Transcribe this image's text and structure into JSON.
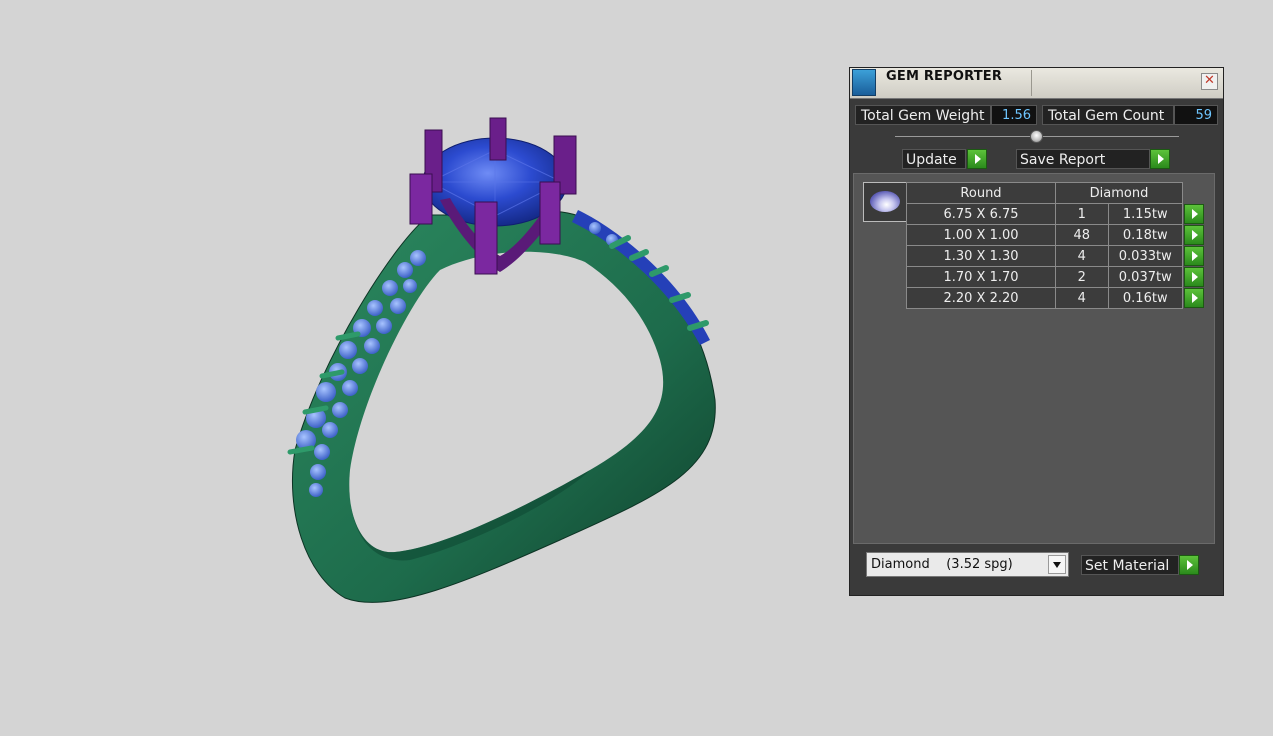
{
  "panel": {
    "title": "GEM REPORTER",
    "close_glyph": "✕",
    "total_weight_label": "Total Gem Weight",
    "total_weight_value": "1.56",
    "total_count_label": "Total Gem Count",
    "total_count_value": "59",
    "update_label": "Update",
    "save_report_label": "Save Report",
    "table": {
      "headers": [
        "Round",
        "Diamond"
      ],
      "rows": [
        {
          "size": "6.75 X 6.75",
          "count": "1",
          "weight": "1.15tw"
        },
        {
          "size": "1.00 X 1.00",
          "count": "48",
          "weight": "0.18tw"
        },
        {
          "size": "1.30 X 1.30",
          "count": "4",
          "weight": "0.033tw"
        },
        {
          "size": "1.70 X 1.70",
          "count": "2",
          "weight": "0.037tw"
        },
        {
          "size": "2.20 X 2.20",
          "count": "4",
          "weight": "0.16tw"
        }
      ]
    },
    "material_select": "Diamond    (3.52 spg)",
    "set_material_label": "Set Material"
  },
  "colors": {
    "background": "#d4d4d4",
    "metal": "#1d6b4b",
    "prongs": "#6a1f8a",
    "gem": "#2a47c8",
    "accent_green": "#3aa82a",
    "value_text": "#6ec6ff"
  },
  "icons": {
    "app": "gem-reporter-app-icon",
    "close": "close-icon",
    "play": "play-arrow-icon",
    "thumb": "round-gem-icon",
    "dropdown": "chevron-down-icon"
  }
}
